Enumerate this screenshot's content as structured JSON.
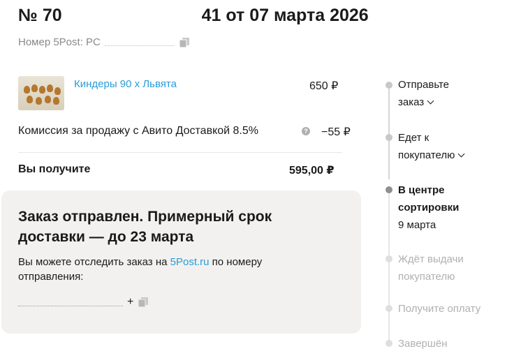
{
  "order": {
    "title_start": "№ 70",
    "title_end": "41 от 07 марта 2026",
    "post_label": "Номер 5Post: PC"
  },
  "item": {
    "name": "Киндеры 90 х Львята",
    "price": "650 ₽"
  },
  "commission": {
    "label": "Комиссия за продажу с Авито Доставкой 8.5%",
    "help": "?",
    "value": "−55 ₽"
  },
  "total": {
    "label": "Вы получите",
    "value": "595,00 ₽"
  },
  "status": {
    "heading": "Заказ отправлен. Примерный срок доставки — до 23 марта",
    "track_before": "Вы можете отследить заказ на ",
    "track_link": "5Post.ru",
    "track_after": " по номеру отправления:",
    "tracking_tail": "+"
  },
  "timeline": {
    "step1_line1": "Отправьте",
    "step1_line2": "заказ",
    "step2_line1": "Едет к",
    "step2_line2": "покупателю",
    "step3_line1": "В центре",
    "step3_line2": "сортировки",
    "step3_date": "9 марта",
    "step4_line1": "Ждёт выдачи",
    "step4_line2": "покупателю",
    "step5": "Получите оплату",
    "step6": "Завершён"
  },
  "colors": {
    "link": "#2a9bd8",
    "card_bg": "#f2f1ef",
    "muted": "#8a8a8a",
    "future": "#b0b0b0"
  }
}
